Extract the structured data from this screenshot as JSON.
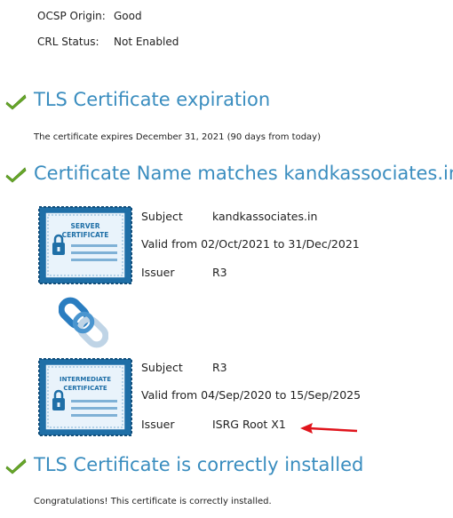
{
  "status": [
    {
      "label": "OCSP Origin:",
      "value": "Good"
    },
    {
      "label": "CRL Status:",
      "value": "Not Enabled"
    }
  ],
  "sections": [
    {
      "title": "TLS Certificate expiration",
      "body": "The certificate expires December 31, 2021 (90 days from today)"
    },
    {
      "title": "Certificate Name matches kandkassociates.in"
    },
    {
      "title": "TLS Certificate is correctly installed",
      "body": "Congratulations! This certificate is correctly installed."
    }
  ],
  "certificates": [
    {
      "badge_line1": "SERVER",
      "badge_line2": "CERTIFICATE",
      "subject_label": "Subject",
      "subject": "kandkassociates.in",
      "valid": "Valid from 02/Oct/2021 to 31/Dec/2021",
      "issuer_label": "Issuer",
      "issuer": "R3"
    },
    {
      "badge_line1": "INTERMEDIATE",
      "badge_line2": "CERTIFICATE",
      "subject_label": "Subject",
      "subject": "R3",
      "valid": "Valid from 04/Sep/2020 to 15/Sep/2025",
      "issuer_label": "Issuer",
      "issuer": "ISRG Root X1"
    }
  ],
  "colors": {
    "heading": "#3a8dbf",
    "check": "#6aaa2a",
    "badge": "#1f6fa7",
    "arrow": "#e0141c"
  },
  "icons": [
    "check-icon",
    "server-certificate-icon",
    "chain-link-icon",
    "intermediate-certificate-icon",
    "red-arrow-icon"
  ]
}
